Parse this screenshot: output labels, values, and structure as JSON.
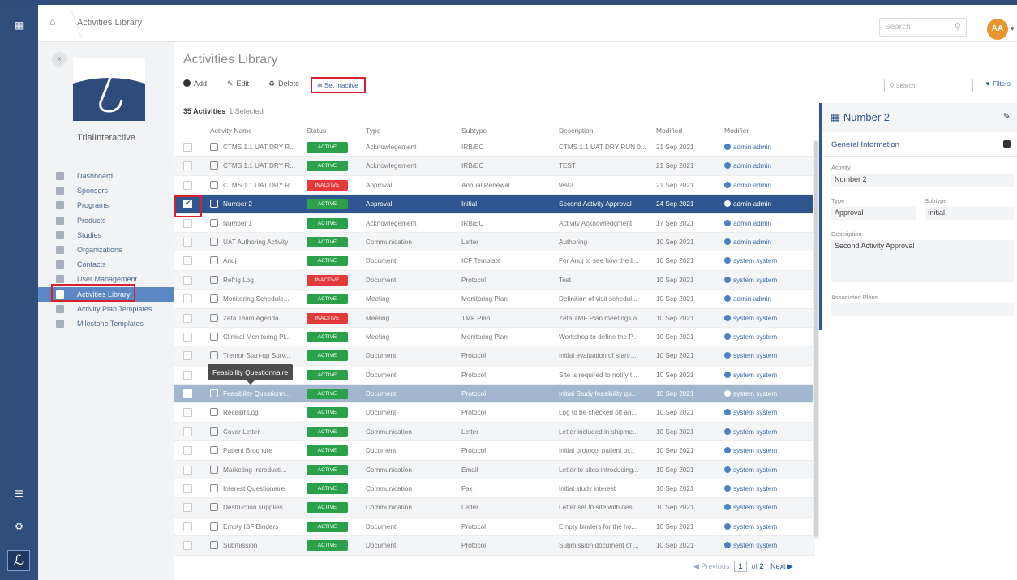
{
  "topbar": {
    "breadcrumb": "Activities Library",
    "search_placeholder": "Search",
    "avatar": "AA"
  },
  "sidebar": {
    "brand": "TrialInteractive",
    "items": [
      {
        "label": "Dashboard",
        "icon": "dashboard-icon"
      },
      {
        "label": "Sponsors",
        "icon": "building-icon"
      },
      {
        "label": "Programs",
        "icon": "flask-icon"
      },
      {
        "label": "Products",
        "icon": "box-icon"
      },
      {
        "label": "Studies",
        "icon": "flask-icon"
      },
      {
        "label": "Organizations",
        "icon": "building-icon"
      },
      {
        "label": "Contacts",
        "icon": "contacts-icon"
      },
      {
        "label": "User Management",
        "icon": "grid-icon"
      },
      {
        "label": "Activities Library",
        "icon": "calendar-icon",
        "selected": true
      },
      {
        "label": "Activity Plan Templates",
        "icon": "template-icon"
      },
      {
        "label": "Milestone Templates",
        "icon": "pin-icon"
      }
    ]
  },
  "main": {
    "title": "Activities Library",
    "toolbar": {
      "add": "Add",
      "edit": "Edit",
      "delete": "Delete",
      "set_inactive": "Set Inactive"
    },
    "count": "35 Activities",
    "selected": "1  Selected",
    "columns": [
      "Activity Name",
      "Status",
      "Type",
      "Subtype",
      "Description",
      "Modified",
      "Modifier"
    ],
    "tooltip": "Feasibility Questionnaire",
    "rows": [
      {
        "name": "CTMS 1.1 UAT DRY R...",
        "status": "ACTIVE",
        "type": "Acknowlegement",
        "subtype": "IRB/EC",
        "description": "CTMS 1.1 UAT DRY RUN 0...",
        "modified": "21 Sep 2021",
        "modifier": "admin admin"
      },
      {
        "name": "CTMS 1.1 UAT DRY R...",
        "status": "ACTIVE",
        "type": "Acknowlegement",
        "subtype": "IRB/EC",
        "description": "TEST",
        "modified": "21 Sep 2021",
        "modifier": "admin admin"
      },
      {
        "name": "CTMS 1.1 UAT DRY R...",
        "status": "INACTIVE",
        "type": "Approval",
        "subtype": "Annual Renewal",
        "description": "test2",
        "modified": "21 Sep 2021",
        "modifier": "admin admin"
      },
      {
        "name": "Number 2",
        "status": "ACTIVE",
        "type": "Approval",
        "subtype": "Initial",
        "description": "Second Activity Approval",
        "modified": "24 Sep 2021",
        "modifier": "admin admin",
        "selected": true
      },
      {
        "name": "Number 1",
        "status": "ACTIVE",
        "type": "Acknowlegement",
        "subtype": "IRB/EC",
        "description": "Activity Acknowledgment",
        "modified": "17 Sep 2021",
        "modifier": "admin admin"
      },
      {
        "name": "UAT Authoring Activity",
        "status": "ACTIVE",
        "type": "Communication",
        "subtype": "Letter",
        "description": "Authoring",
        "modified": "10 Sep 2021",
        "modifier": "admin admin"
      },
      {
        "name": "Anuj",
        "status": "ACTIVE",
        "type": "Document",
        "subtype": "ICF Template",
        "description": "For Anuj to see how the li...",
        "modified": "10 Sep 2021",
        "modifier": "system system"
      },
      {
        "name": "Refrig Log",
        "status": "INACTIVE",
        "type": "Document",
        "subtype": "Protocol",
        "description": "Test",
        "modified": "10 Sep 2021",
        "modifier": "system system"
      },
      {
        "name": "Monitoring Schedule...",
        "status": "ACTIVE",
        "type": "Meeting",
        "subtype": "Monitoring Plan",
        "description": "Definition of visit schedul...",
        "modified": "10 Sep 2021",
        "modifier": "admin admin"
      },
      {
        "name": "Zeta Team Agenda",
        "status": "INACTIVE",
        "type": "Meeting",
        "subtype": "TMF Plan",
        "description": "Zeta TMF Plan meetings a...",
        "modified": "10 Sep 2021",
        "modifier": "system system"
      },
      {
        "name": "Clinical Monitoring Pl...",
        "status": "ACTIVE",
        "type": "Meeting",
        "subtype": "Monitoring Plan",
        "description": "Workshop to define the P...",
        "modified": "10 Sep 2021",
        "modifier": "system system"
      },
      {
        "name": "Tremor Start-up Surv...",
        "status": "ACTIVE",
        "type": "Document",
        "subtype": "Protocol",
        "description": "Initial evaluation of start-...",
        "modified": "10 Sep 2021",
        "modifier": "system system"
      },
      {
        "name": "",
        "status": "ACTIVE",
        "type": "Document",
        "subtype": "Protocol",
        "description": "Site is required to notify t...",
        "modified": "10 Sep 2021",
        "modifier": "system system"
      },
      {
        "name": "Feasibility Questionn...",
        "status": "ACTIVE",
        "type": "Document",
        "subtype": "Protocol",
        "description": "Initial Study feasibility qu...",
        "modified": "10 Sep 2021",
        "modifier": "system system",
        "hover": true
      },
      {
        "name": "Receipt Log",
        "status": "ACTIVE",
        "type": "Document",
        "subtype": "Protocol",
        "description": "Log to be checked off an...",
        "modified": "10 Sep 2021",
        "modifier": "system system"
      },
      {
        "name": "Cover Letter",
        "status": "ACTIVE",
        "type": "Communication",
        "subtype": "Letter",
        "description": "Letter included in shipme...",
        "modified": "10 Sep 2021",
        "modifier": "system system"
      },
      {
        "name": "Patient Brochure",
        "status": "ACTIVE",
        "type": "Document",
        "subtype": "Protocol",
        "description": "Initial protocol patient br...",
        "modified": "10 Sep 2021",
        "modifier": "system system"
      },
      {
        "name": "Marketing Introducti...",
        "status": "ACTIVE",
        "type": "Communication",
        "subtype": "Email",
        "description": "Letter to sites introducing...",
        "modified": "10 Sep 2021",
        "modifier": "system system"
      },
      {
        "name": "Interest Questionaire",
        "status": "ACTIVE",
        "type": "Communication",
        "subtype": "Fax",
        "description": "Initial study interest",
        "modified": "10 Sep 2021",
        "modifier": "system system"
      },
      {
        "name": "Destruction supplies ...",
        "status": "ACTIVE",
        "type": "Communication",
        "subtype": "Letter",
        "description": "Letter set to site with des...",
        "modified": "10 Sep 2021",
        "modifier": "system system"
      },
      {
        "name": "Empty ISF Binders",
        "status": "ACTIVE",
        "type": "Document",
        "subtype": "Protocol",
        "description": "Empty binders for the ho...",
        "modified": "10 Sep 2021",
        "modifier": "system system"
      },
      {
        "name": "Submission",
        "status": "ACTIVE",
        "type": "Document",
        "subtype": "Protocol",
        "description": "Submission document of ...",
        "modified": "10 Sep 2021",
        "modifier": "system system"
      }
    ],
    "pager": {
      "previous": "Previous",
      "page": "1",
      "of": "of",
      "total": "2",
      "next": "Next"
    }
  },
  "detail": {
    "search_placeholder": "Search",
    "filters": "Filters",
    "title": "Number 2",
    "section": "General Information",
    "activity_label": "Activity",
    "activity": "Number 2",
    "type_label": "Type",
    "type": "Approval",
    "subtype_label": "Subtype",
    "subtype": "Initial",
    "description_label": "Description",
    "description": "Second Activity Approval",
    "plans_label": "Associated Plans",
    "plans": ""
  },
  "colors": {
    "navy": "#2f4e7c",
    "selected_row": "#2f568e",
    "active": "#2aa14a",
    "inactive": "#e23a3a",
    "accent_orange": "#e8962c",
    "highlight_red": "#d5212b"
  }
}
